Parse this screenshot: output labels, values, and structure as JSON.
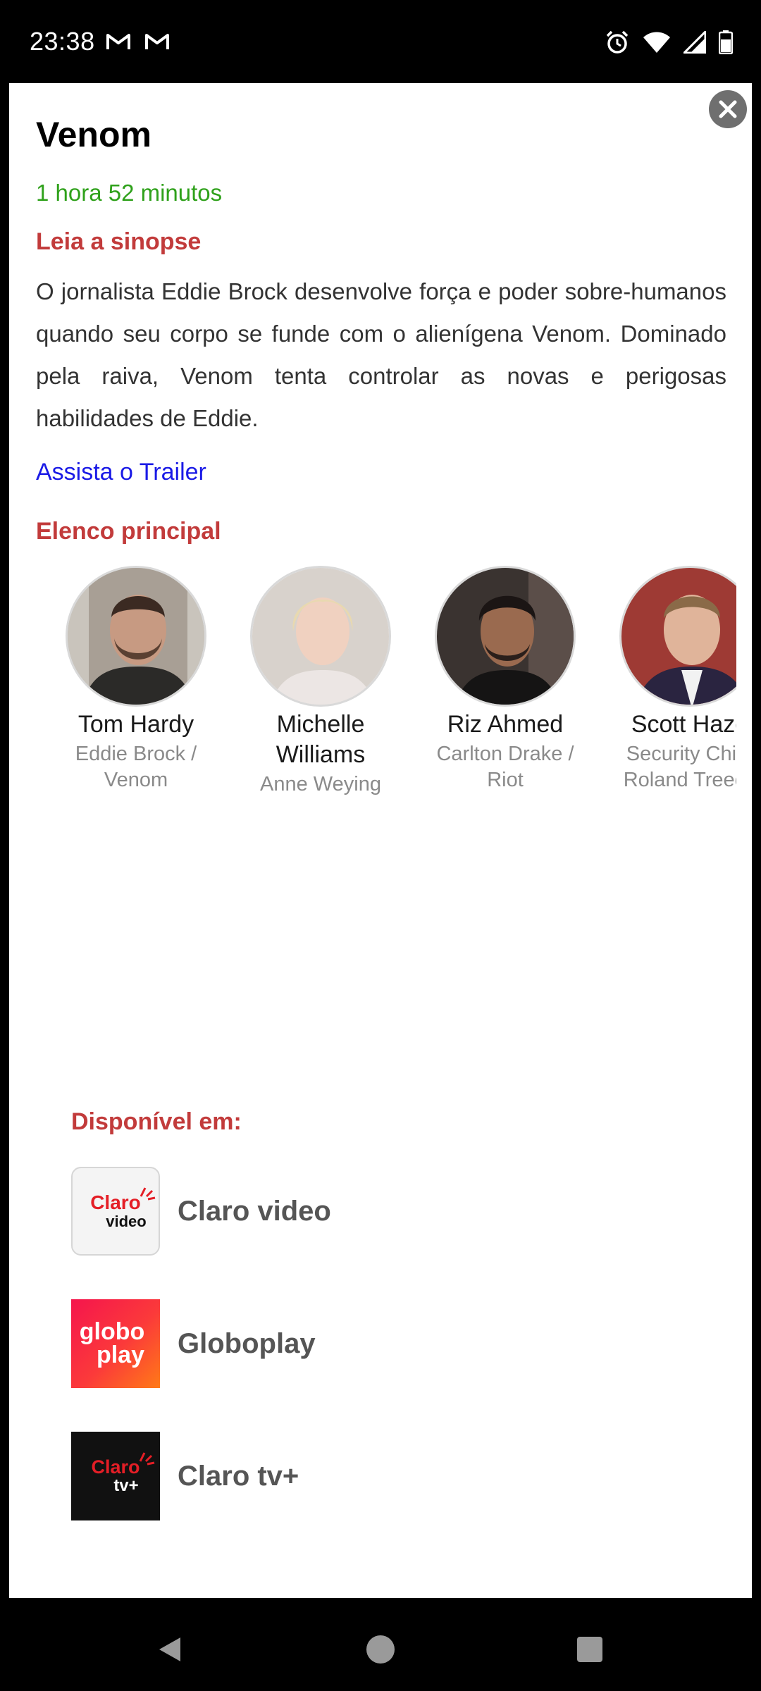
{
  "status_bar": {
    "time": "23:38"
  },
  "movie": {
    "title": "Venom",
    "duration": "1 hora 52 minutos",
    "synopsis_heading": "Leia a sinopse",
    "synopsis": "O jornalista Eddie Brock desenvolve força e poder sobre-humanos quando seu corpo se funde com o alienígena Venom. Dominado pela raiva, Venom tenta controlar as novas e perigosas habilidades de Eddie.",
    "trailer_link": "Assista o Trailer"
  },
  "cast_heading": "Elenco principal",
  "cast": [
    {
      "name": "Tom Hardy",
      "role": "Eddie Brock / Venom"
    },
    {
      "name": "Michelle Williams",
      "role": "Anne Weying"
    },
    {
      "name": "Riz Ahmed",
      "role": "Carlton Drake / Riot"
    },
    {
      "name": "Scott Haze",
      "role": "Security Chief Roland Treece"
    }
  ],
  "availability": {
    "heading": "Disponível em:",
    "providers": [
      {
        "name": "Claro video",
        "logo_line1": "Claro",
        "logo_line2": "video"
      },
      {
        "name": "Globoplay",
        "logo_line1": "globo",
        "logo_line2": "play"
      },
      {
        "name": "Claro tv+",
        "logo_line1": "Claro",
        "logo_line2": "tv+"
      }
    ]
  },
  "colors": {
    "accent_red": "#c23b3b",
    "duration_green": "#2fa11b",
    "link_blue": "#1a1ae6"
  }
}
